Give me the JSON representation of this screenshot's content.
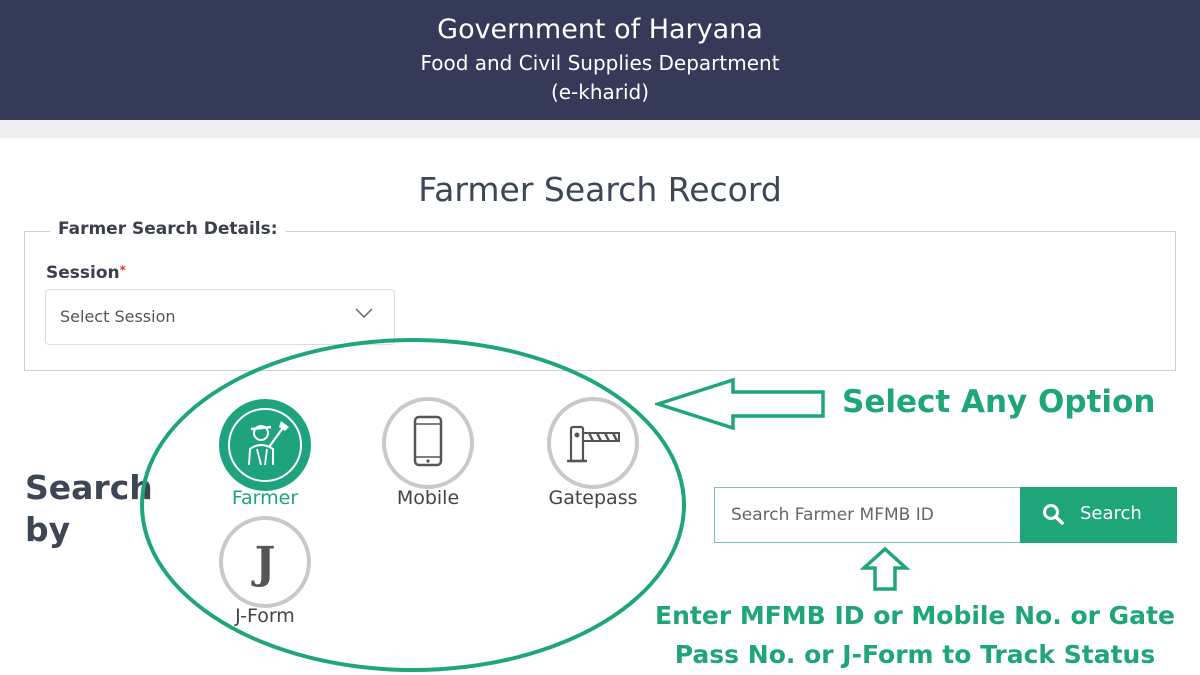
{
  "header": {
    "title": "Government of Haryana",
    "department": "Food and Civil Supplies Department",
    "subtitle": "(e-kharid)"
  },
  "page": {
    "title": "Farmer Search Record"
  },
  "search_details": {
    "legend": "Farmer Search Details:",
    "session_label": "Session",
    "required_mark": "*",
    "session_placeholder": "Select Session"
  },
  "search_by": {
    "label_line1": "Search",
    "label_line2": "by",
    "options": [
      {
        "label": "Farmer",
        "icon": "farmer-icon",
        "selected": true
      },
      {
        "label": "Mobile",
        "icon": "mobile-phone-icon",
        "selected": false
      },
      {
        "label": "Gatepass",
        "icon": "gate-barrier-icon",
        "selected": false
      },
      {
        "label": "J-Form",
        "icon": "j-form-icon",
        "selected": false
      }
    ]
  },
  "search": {
    "placeholder": "Search Farmer MFMB ID",
    "button_label": "Search"
  },
  "annotations": {
    "select_option": "Select Any Option",
    "enter_line1": "Enter MFMB ID or Mobile No. or Gate",
    "enter_line2": "Pass No. or J-Form to Track Status"
  },
  "colors": {
    "header_bg": "#353a58",
    "accent": "#1ea57a",
    "required": "#e53935"
  }
}
